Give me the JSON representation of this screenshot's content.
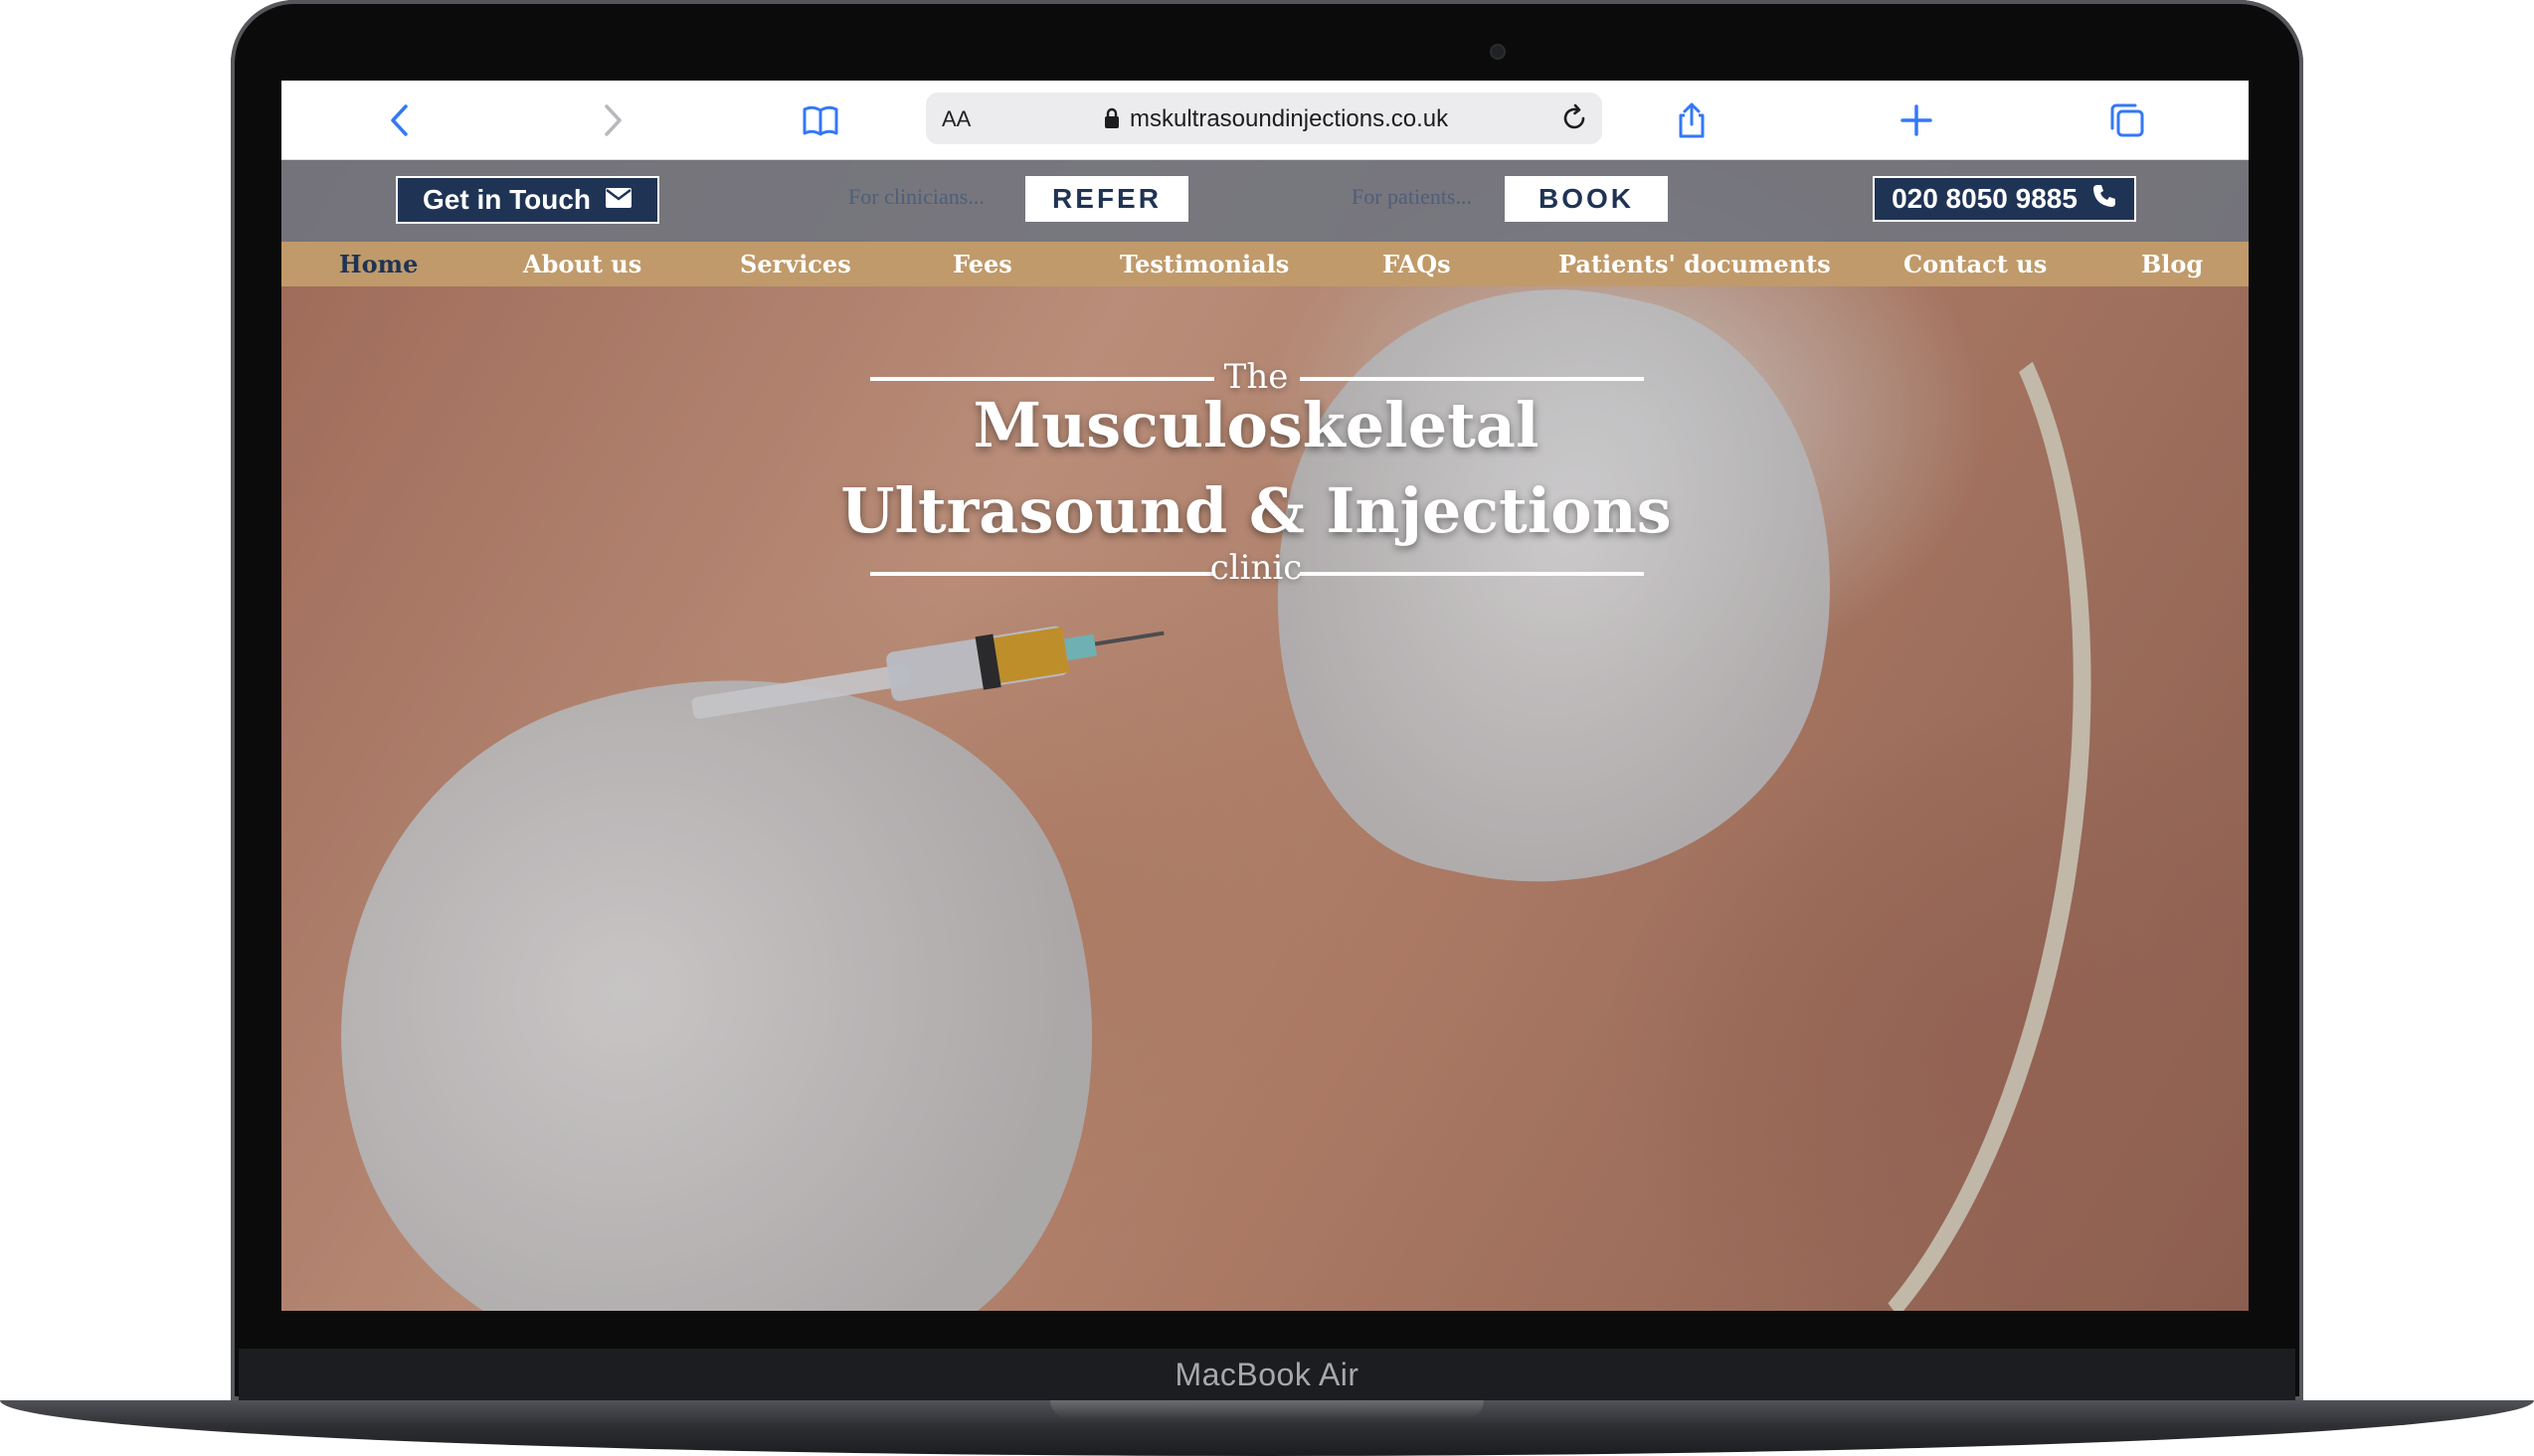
{
  "browser": {
    "text_size_label": "AA",
    "url": "mskultrasoundinjections.co.uk"
  },
  "utility": {
    "get_in_touch": "Get in Touch",
    "clinicians_hint": "For clinicians...",
    "refer": "REFER",
    "patients_hint": "For patients...",
    "book": "BOOK",
    "phone": "020 8050 9885"
  },
  "nav": {
    "items": [
      "Home",
      "About us",
      "Services",
      "Fees",
      "Testimonials",
      "FAQs",
      "Patients' documents",
      "Contact us",
      "Blog"
    ],
    "active": "Home"
  },
  "hero": {
    "the": "The",
    "line1": "Musculoskeletal",
    "line2": "Ultrasound & Injections",
    "clinic": "clinic"
  },
  "device": {
    "label": "MacBook Air"
  },
  "colors": {
    "navy": "#1f3354",
    "gold_nav": "#c09a6a",
    "ios_blue": "#3478f6"
  }
}
